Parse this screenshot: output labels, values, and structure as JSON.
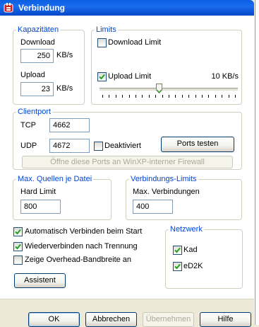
{
  "window": {
    "title": "Verbindung",
    "app_icon": "emule-icon"
  },
  "kapazitaeten": {
    "legend": "Kapazitäten",
    "download_label": "Download",
    "download_value": "250",
    "download_unit": "KB/s",
    "upload_label": "Upload",
    "upload_value": "23",
    "upload_unit": "KB/s"
  },
  "limits": {
    "legend": "Limits",
    "download_limit_label": "Download Limit",
    "download_limit_checked": false,
    "upload_limit_label": "Upload Limit",
    "upload_limit_checked": true,
    "upload_limit_value": "10 KB/s",
    "slider_fraction": 0.43
  },
  "clientport": {
    "legend": "Clientport",
    "tcp_label": "TCP",
    "tcp_value": "4662",
    "udp_label": "UDP",
    "udp_value": "4672",
    "deaktiviert_label": "Deaktiviert",
    "deaktiviert_checked": false,
    "test_button": "Ports testen",
    "firewall_button": "Öffne diese Ports an WinXP-interner Firewall"
  },
  "quellen": {
    "legend": "Max. Quellen je Datei",
    "hard_limit_label": "Hard Limit",
    "hard_limit_value": "800"
  },
  "verbindungs_limits": {
    "legend": "Verbindungs-Limits",
    "max_label": "Max. Verbindungen",
    "max_value": "400"
  },
  "options": {
    "auto_connect_label": "Automatisch Verbinden beim Start",
    "auto_connect_checked": true,
    "reconnect_label": "Wiederverbinden nach Trennung",
    "reconnect_checked": true,
    "overhead_label": "Zeige Overhead-Bandbreite an",
    "overhead_checked": false,
    "wizard_button": "Assistent"
  },
  "netzwerk": {
    "legend": "Netzwerk",
    "kad_label": "Kad",
    "kad_checked": true,
    "ed2k_label": "eD2K",
    "ed2k_checked": true
  },
  "buttons": {
    "ok": "OK",
    "cancel": "Abbrechen",
    "apply": "Übernehmen",
    "help": "Hilfe"
  },
  "colors": {
    "titlebar": "#0a5fe0",
    "group_legend": "#0046d5",
    "dialog_bg": "#ece9d8"
  }
}
